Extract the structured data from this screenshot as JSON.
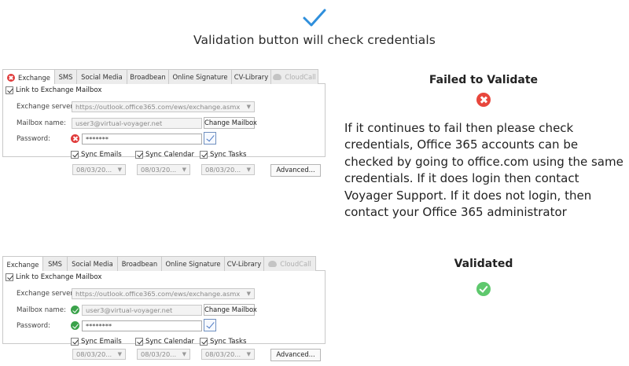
{
  "headline": "Validation button will check credentials",
  "panels": [
    {
      "tabs": [
        "Exchange",
        "SMS",
        "Social Media",
        "Broadbean",
        "Online Signature",
        "CV-Library",
        "CloudCall"
      ],
      "link_label": "Link to Exchange Mailbox",
      "server_label": "Exchange server:",
      "server_value": "https://outlook.office365.com/ews/exchange.asmx",
      "mailbox_label": "Mailbox name:",
      "mailbox_value": "user3@virtual-voyager.net",
      "change_mailbox": "Change Mailbox",
      "password_label": "Password:",
      "password_value": "*******",
      "sync_emails": "Sync Emails",
      "sync_calendar": "Sync Calendar",
      "sync_tasks": "Sync Tasks",
      "date1": "08/03/20...",
      "date2": "08/03/20...",
      "date3": "08/03/20...",
      "advanced": "Advanced...",
      "mailbox_status": "none",
      "password_status": "error",
      "tab_status": "error"
    },
    {
      "tabs": [
        "Exchange",
        "SMS",
        "Social Media",
        "Broadbean",
        "Online Signature",
        "CV-Library",
        "CloudCall"
      ],
      "link_label": "Link to Exchange Mailbox",
      "server_label": "Exchange server:",
      "server_value": "https://outlook.office365.com/ews/exchange.asmx",
      "mailbox_label": "Mailbox name:",
      "mailbox_value": "user3@virtual-voyager.net",
      "change_mailbox": "Change Mailbox",
      "password_label": "Password:",
      "password_value": "********",
      "sync_emails": "Sync Emails",
      "sync_calendar": "Sync Calendar",
      "sync_tasks": "Sync Tasks",
      "date1": "08/03/20...",
      "date2": "08/03/20...",
      "date3": "08/03/20...",
      "advanced": "Advanced...",
      "mailbox_status": "ok",
      "password_status": "ok",
      "tab_status": "none"
    }
  ],
  "failed_title": "Failed to Validate",
  "failed_message": "If it continues to fail then please check credentials, Office 365 accounts can be checked by going to office.com using the same credentials.  If it does login then contact Voyager Support.  If it does not login, then contact your Office 365 administrator",
  "validated_title": "Validated",
  "colors": {
    "accent_check": "#2f8fdc",
    "error": "#e8463c",
    "success": "#5ec86d"
  }
}
